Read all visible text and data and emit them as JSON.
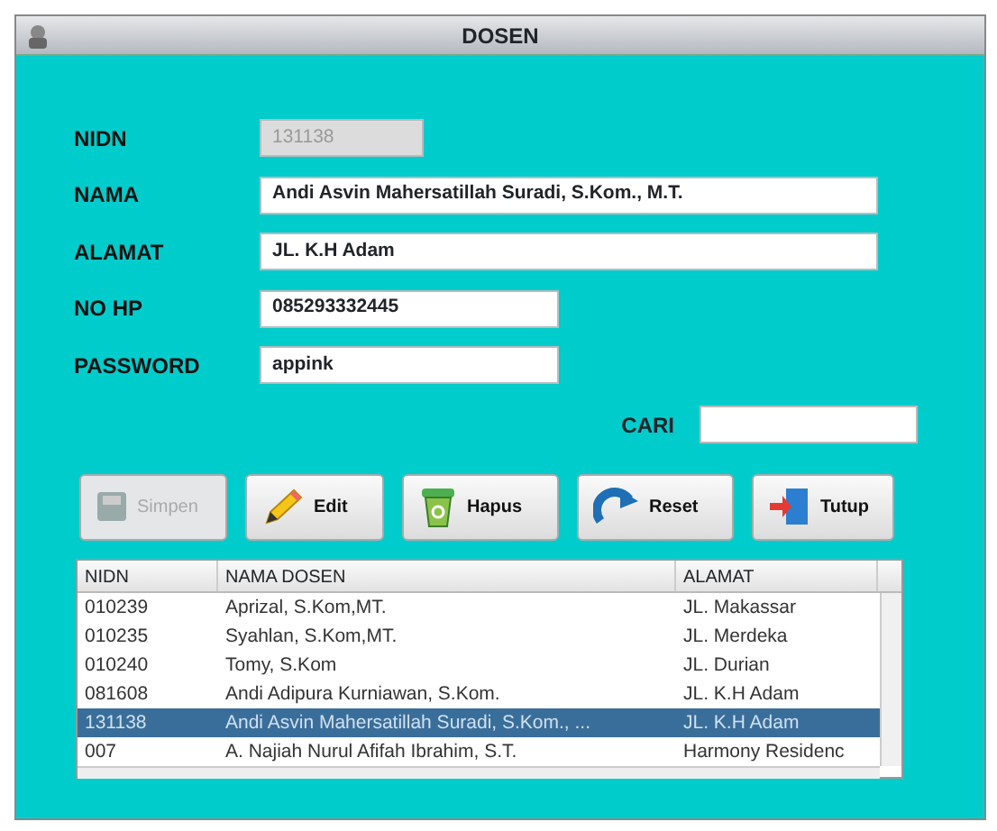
{
  "window": {
    "title": "DOSEN"
  },
  "fields": [
    {
      "label": "NIDN",
      "value": "131138",
      "disabled": true
    },
    {
      "label": "NAMA",
      "value": "Andi Asvin Mahersatillah Suradi, S.Kom., M.T.",
      "disabled": false
    },
    {
      "label": "ALAMAT",
      "value": "JL. K.H Adam",
      "disabled": false
    },
    {
      "label": "NO HP",
      "value": "085293332445",
      "disabled": false
    },
    {
      "label": "PASSWORD",
      "value": "appink",
      "disabled": false
    }
  ],
  "search": {
    "label": "CARI"
  },
  "buttons": [
    {
      "label": "Simpen",
      "kind": "save",
      "disabled": true
    },
    {
      "label": "Edit",
      "kind": "edit",
      "disabled": false
    },
    {
      "label": "Hapus",
      "kind": "delete",
      "disabled": false
    },
    {
      "label": "Reset",
      "kind": "reset",
      "disabled": false
    },
    {
      "label": "Tutup",
      "kind": "close",
      "disabled": false
    }
  ],
  "table": {
    "columns": [
      "NIDN",
      "NAMA DOSEN",
      "ALAMAT"
    ],
    "rows": [
      {
        "cells": [
          "010239",
          "Aprizal, S.Kom,MT.",
          "JL. Makassar"
        ],
        "selected": false
      },
      {
        "cells": [
          "010235",
          "Syahlan, S.Kom,MT.",
          "JL. Merdeka"
        ],
        "selected": false
      },
      {
        "cells": [
          "010240",
          "Tomy, S.Kom",
          "JL. Durian"
        ],
        "selected": false
      },
      {
        "cells": [
          "081608",
          "Andi Adipura Kurniawan, S.Kom.",
          "JL. K.H Adam"
        ],
        "selected": false
      },
      {
        "cells": [
          "131138",
          "Andi Asvin Mahersatillah Suradi, S.Kom., ...",
          "JL. K.H Adam"
        ],
        "selected": true
      },
      {
        "cells": [
          "007",
          "A. Najiah Nurul Afifah Ibrahim, S.T.",
          "Harmony Residenc"
        ],
        "selected": false
      }
    ]
  }
}
